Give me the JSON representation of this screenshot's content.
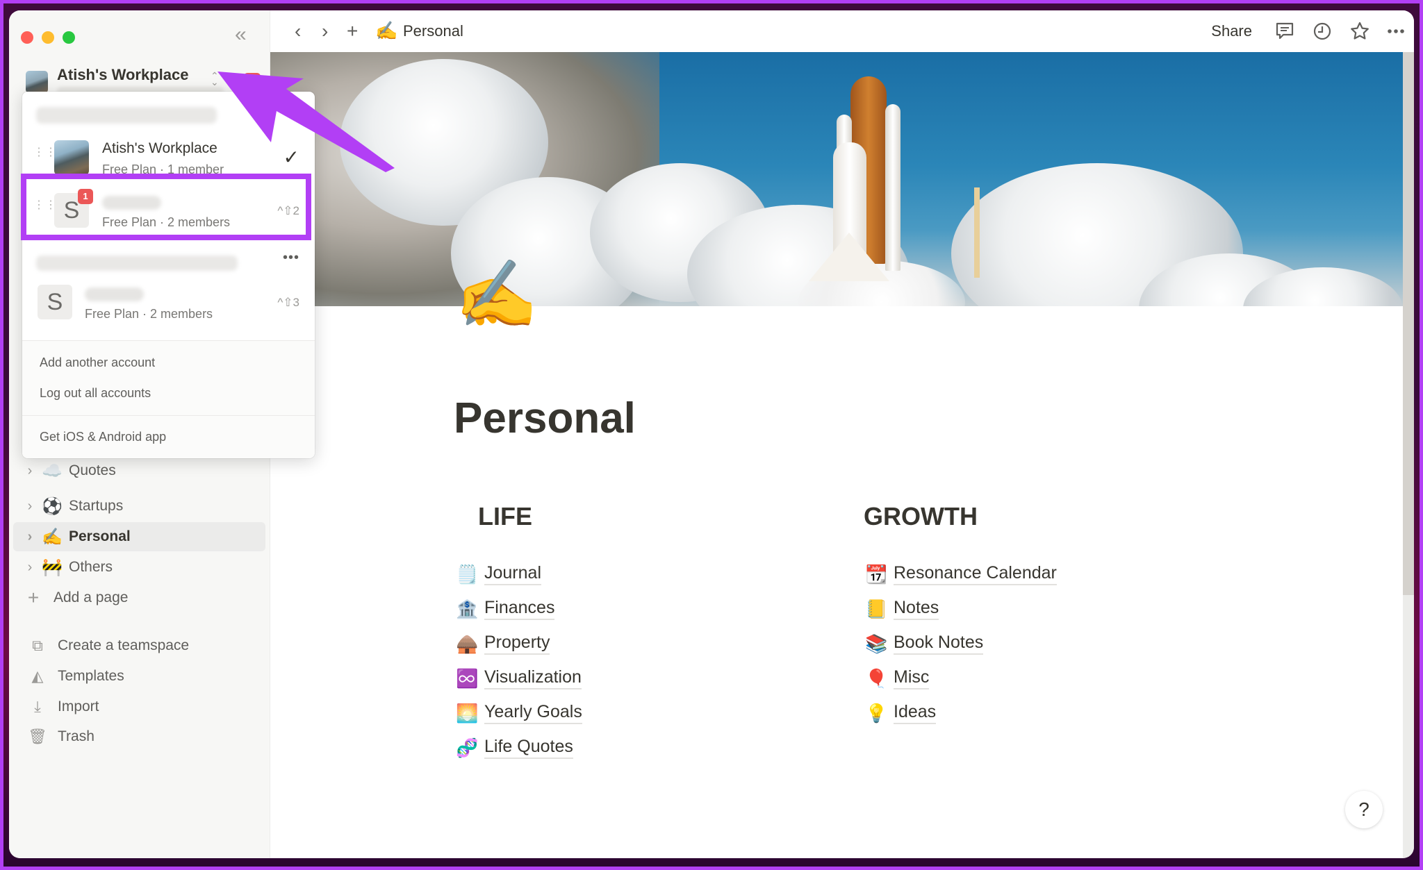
{
  "window": {
    "breadcrumb": {
      "emoji": "✍️",
      "label": "Personal"
    },
    "toolbar": {
      "share_label": "Share",
      "icons": [
        "chevron-left-icon",
        "chevron-right-icon",
        "plus-icon",
        "comment-icon",
        "clock-icon",
        "star-icon",
        "more-icon"
      ]
    }
  },
  "sidebar": {
    "workspace": {
      "name": "Atish's Workplace",
      "notification_count": "1"
    },
    "pages": [
      {
        "emoji": "☁️",
        "label": "Quotes"
      },
      {
        "emoji": "⚽",
        "label": "Startups"
      },
      {
        "emoji": "✍️",
        "label": "Personal",
        "active": true
      },
      {
        "emoji": "🚧",
        "label": "Others"
      }
    ],
    "add_page_label": "Add a page",
    "utilities": [
      {
        "icon": "teamspace-icon",
        "label": "Create a teamspace"
      },
      {
        "icon": "templates-icon",
        "label": "Templates"
      },
      {
        "icon": "import-icon",
        "label": "Import"
      },
      {
        "icon": "trash-icon",
        "label": "Trash"
      }
    ]
  },
  "workspace_menu": {
    "accounts": [
      {
        "workspaces": [
          {
            "avatar": "",
            "name": "Atish's Workplace",
            "subtitle": "Free Plan · 1 member",
            "selected": true
          },
          {
            "avatar": "S",
            "name": "",
            "subtitle": "Free Plan · 2 members",
            "shortcut": "^⇧2",
            "notification_count": "1",
            "highlighted": true
          }
        ]
      },
      {
        "workspaces": [
          {
            "avatar": "S",
            "name": "",
            "subtitle": "Free Plan · 2 members",
            "shortcut": "^⇧3"
          }
        ]
      }
    ],
    "more_label": "•••",
    "footer": {
      "add_account": "Add another account",
      "log_out_all": "Log out all accounts",
      "get_app": "Get iOS & Android app"
    }
  },
  "page": {
    "icon": "✍️",
    "title": "Personal",
    "columns": [
      {
        "heading": "LIFE",
        "links": [
          {
            "emoji": "🗒️",
            "label": "Journal"
          },
          {
            "emoji": "🏦",
            "label": "Finances"
          },
          {
            "emoji": "🛖",
            "label": "Property"
          },
          {
            "emoji": "♾️",
            "label": "Visualization"
          },
          {
            "emoji": "🌅",
            "label": "Yearly Goals"
          },
          {
            "emoji": "🧬",
            "label": "Life Quotes"
          }
        ]
      },
      {
        "heading": "GROWTH",
        "links": [
          {
            "emoji": "📆",
            "label": "Resonance Calendar"
          },
          {
            "emoji": "📒",
            "label": "Notes"
          },
          {
            "emoji": "📚",
            "label": "Book Notes"
          },
          {
            "emoji": "🎈",
            "label": "Misc"
          },
          {
            "emoji": "💡",
            "label": "Ideas"
          }
        ]
      }
    ],
    "help_label": "?"
  },
  "annotation": {
    "highlight_color": "#b23ff5"
  }
}
